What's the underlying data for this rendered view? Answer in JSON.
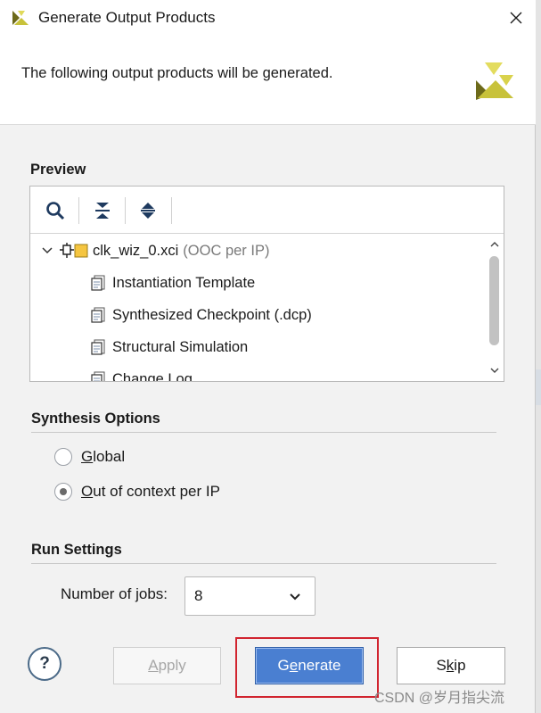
{
  "window": {
    "title": "Generate Output Products"
  },
  "header": {
    "message": "The following output products will be generated."
  },
  "preview": {
    "title": "Preview",
    "toolbar": [
      {
        "icon": "search-icon"
      },
      {
        "icon": "collapse-all-icon"
      },
      {
        "icon": "expand-all-icon"
      }
    ],
    "tree": {
      "root": {
        "label": "clk_wiz_0.xci",
        "note": "(OOC per IP)",
        "expanded": true
      },
      "children": [
        {
          "label": "Instantiation Template"
        },
        {
          "label": "Synthesized Checkpoint (.dcp)"
        },
        {
          "label": "Structural Simulation"
        },
        {
          "label": "Change Log"
        }
      ]
    }
  },
  "synthesis": {
    "title": "Synthesis Options",
    "options": [
      {
        "mnemonic": "G",
        "rest": "lobal",
        "checked": false
      },
      {
        "mnemonic": "O",
        "rest": "ut of context per IP",
        "checked": true
      }
    ]
  },
  "run": {
    "title": "Run Settings",
    "jobs_label_pre": "Number of ",
    "jobs_label_mn": "j",
    "jobs_label_post": "obs:",
    "jobs_value": "8"
  },
  "footer": {
    "help": "?",
    "apply_mn": "A",
    "apply_rest": "pply",
    "generate_pre": "G",
    "generate_mn": "e",
    "generate_post": "nerate",
    "skip_pre": "S",
    "skip_mn": "k",
    "skip_post": "ip"
  },
  "colors": {
    "primary": "#4a7fd1",
    "highlight": "#d1242f",
    "logo_light": "#c8c23a",
    "logo_dark": "#6d6a1a"
  },
  "watermark": "CSDN @岁月指尖流"
}
